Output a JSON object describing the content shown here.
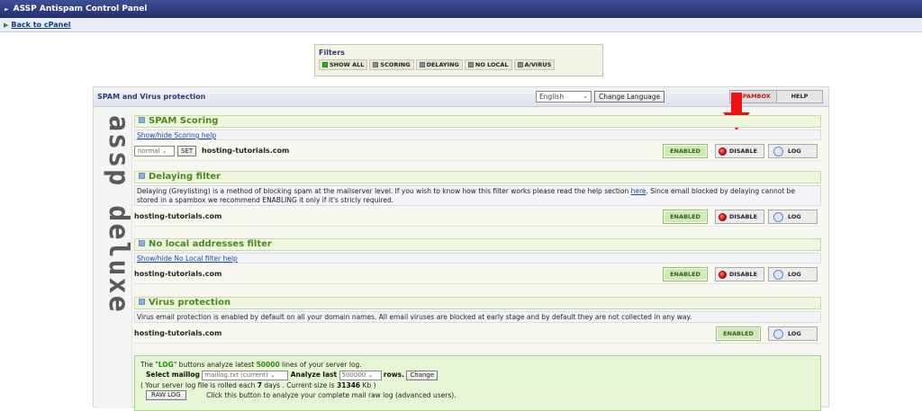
{
  "app": {
    "title": "ASSP Antispam Control Panel",
    "back_link": "Back to cPanel"
  },
  "filters": {
    "title": "Filters",
    "buttons": [
      "SHOW ALL",
      "SCORING",
      "DELAYING",
      "NO LOCAL",
      "A/VIRUS"
    ]
  },
  "panel": {
    "title": "SPAM and Virus protection",
    "language_value": "English",
    "change_language": "Change Language",
    "spambox": "SPAMBOX",
    "help": "HELP",
    "brand": "assp deluxe"
  },
  "sections": {
    "scoring": {
      "title": "SPAM Scoring",
      "help_link": "Show/hide Scoring help",
      "level_value": "normal",
      "set_label": "SET",
      "domain": "hosting-tutorials.com",
      "status": "ENABLED",
      "disable": "DISABLE",
      "log": "LOG"
    },
    "delaying": {
      "title": "Delaying filter",
      "desc_1": "Delaying (Greylisting) is a method of blocking spam at the mailserver level. If you wish to know how this filter works please read the help section ",
      "desc_link": "here",
      "desc_2": ". Since email blocked by delaying cannot be stored in a spambox we recommend ENABLING it only if it's stricly required.",
      "domain": "hosting-tutorials.com",
      "status": "ENABLED",
      "disable": "DISABLE",
      "log": "LOG"
    },
    "nolocal": {
      "title": "No local addresses filter",
      "help_link": "Show/hide No Local filter help",
      "domain": "hosting-tutorials.com",
      "status": "ENABLED",
      "disable": "DISABLE",
      "log": "LOG"
    },
    "virus": {
      "title": "Virus protection",
      "desc": "Virus email protection is enabled by default on all your domain names. All email viruses are blocked at early stage and by default they are not collected in any way.",
      "domain": "hosting-tutorials.com",
      "status": "ENABLED",
      "log": "LOG"
    }
  },
  "logbox": {
    "line1_a": "The \"",
    "line1_log": "LOG",
    "line1_b": "\" buttons analyze latest ",
    "line1_num": "50000",
    "line1_c": " lines of your server log.",
    "select_label": "Select maillog",
    "maillog_value": "maillog.txt (current)",
    "analyze_label": "Analyze last",
    "rows_value": "500000",
    "rows_label": "rows.",
    "change": "Change",
    "line3_a": "( Your server log file is rolled each ",
    "line3_days": "7",
    "line3_b": " days . Current size is ",
    "line3_size": "31346",
    "line3_c": " Kb )",
    "rawlog": "RAW LOG",
    "rawlog_desc": "Click this button to analyze your complete mail raw log (advanced users)."
  }
}
